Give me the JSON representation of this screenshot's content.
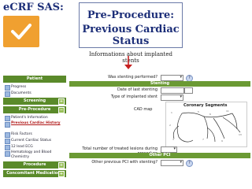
{
  "header": {
    "ecrf_label": "eCRF SAS:",
    "title_line1": "Pre-Procedure:",
    "title_line2": "Previous Cardiac Status",
    "info": "Informations about implanted stents",
    "colors": {
      "title": "#1c2e78",
      "arrow": "#c62020",
      "logo": "#f0a030"
    }
  },
  "sidebar": {
    "sections": [
      {
        "label": "Patient",
        "items": [
          {
            "label": "Progress"
          },
          {
            "label": "Documents"
          }
        ]
      },
      {
        "label": "Screening",
        "items": []
      },
      {
        "label": "Pre-Procedure",
        "items": [
          {
            "label": "Patient's Information"
          },
          {
            "label": "Previous Cardiac History",
            "active": true
          },
          {
            "label": "Risk Factors"
          },
          {
            "label": "Current Cardiac Status"
          },
          {
            "label": "12 lead ECG"
          },
          {
            "label": "Hematology and Blood Chemistry"
          }
        ]
      },
      {
        "label": "Procedure",
        "items": []
      },
      {
        "label": "Concomitant Medications",
        "items": []
      }
    ]
  },
  "form": {
    "q_stenting": "Was stenting performed?",
    "stenting_bar": "Stenting",
    "q_date": "Date of last stenting",
    "q_type": "Type of implanted stent",
    "cad_map": "CAD map",
    "coronary_caption": "Coronary Segments",
    "q_total": "Total number of treated lesions during procedure",
    "other_bar": "Other PCI",
    "q_other": "Other previous PCI with stenting?"
  }
}
